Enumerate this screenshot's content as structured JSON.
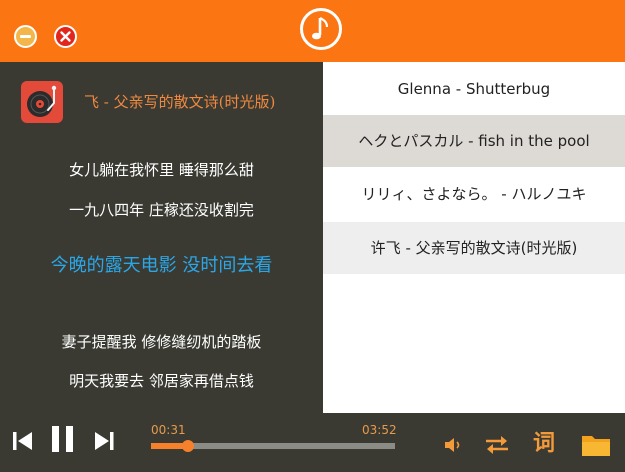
{
  "now_playing": {
    "title": "许飞 - 父亲写的散文诗(时光版)",
    "shown_title": "飞 - 父亲写的散文诗(时光版)"
  },
  "lyrics": [
    {
      "text": "女儿躺在我怀里  睡得那么甜",
      "active": false
    },
    {
      "text": "一九八四年  庄稼还没收割完",
      "active": false
    },
    {
      "text": "今晚的露天电影  没时间去看",
      "active": true
    },
    {
      "text": "",
      "active": false
    },
    {
      "text": "妻子提醒我  修修缝纫机的踏板",
      "active": false
    },
    {
      "text": "明天我要去  邻居家再借点钱",
      "active": false
    }
  ],
  "playlist": [
    {
      "label": "Glenna - Shutterbug",
      "selected": false
    },
    {
      "label": "ヘクとパスカル - fish in the pool",
      "selected": true
    },
    {
      "label": "リリィ、さよなら。 - ハルノユキ",
      "selected": false
    },
    {
      "label": "许飞 - 父亲写的散文诗(时光版)",
      "selected": false
    }
  ],
  "player": {
    "current_time": "00:31",
    "total_time": "03:52",
    "progress": 0.15,
    "lyric_button_label": "词"
  },
  "colors": {
    "accent": "#fb7512",
    "panel": "#3a3a33",
    "active_lyric": "#2aa7e8",
    "selected_row": "#ddd9d5",
    "alt_row": "#eeeeee"
  },
  "icons": {
    "logo": "music-note-icon",
    "minimize": "minimize-icon",
    "close": "close-icon",
    "album": "turntable-icon",
    "prev": "previous-icon",
    "play_pause": "pause-icon",
    "next": "next-icon",
    "volume": "volume-icon",
    "repeat": "repeat-icon",
    "folder": "folder-icon"
  }
}
